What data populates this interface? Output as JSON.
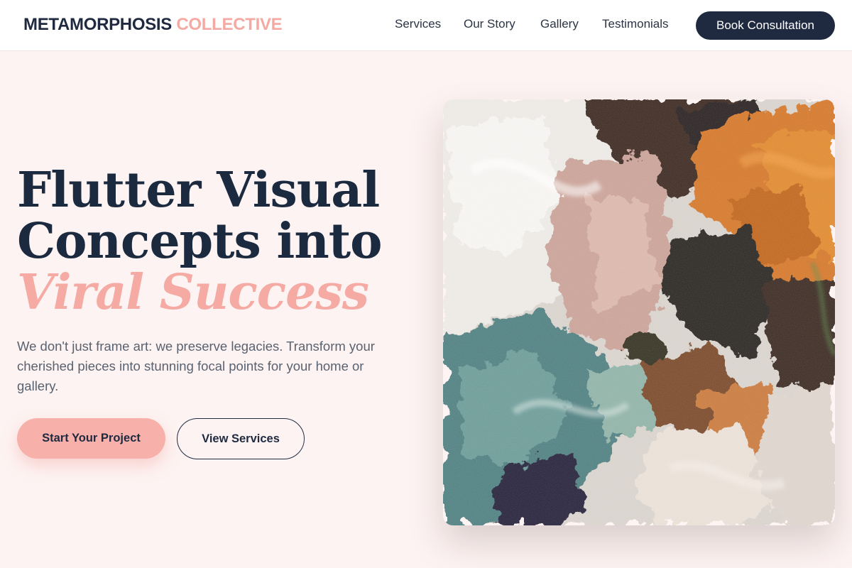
{
  "header": {
    "logo_main": "METAMORPHOSIS",
    "logo_accent": "COLLECTIVE",
    "nav": {
      "services": "Services",
      "story": "Our Story",
      "gallery": "Gallery",
      "testimonials": "Testimonials"
    },
    "cta_label": "Book Consultation"
  },
  "hero": {
    "title_line1": "Flutter Visual",
    "title_line2": "Concepts into",
    "title_highlight": "Viral Success",
    "description": "We don't just frame art: we preserve legacies. Transform your cherished pieces into stunning focal points for your home or gallery.",
    "primary_button": "Start Your Project",
    "secondary_button": "View Services",
    "image_alt": "Textured abstract oil painting"
  },
  "colors": {
    "navy": "#1f2a40",
    "accent_pink": "#f5a9a3",
    "background": "#fdf3f2"
  }
}
